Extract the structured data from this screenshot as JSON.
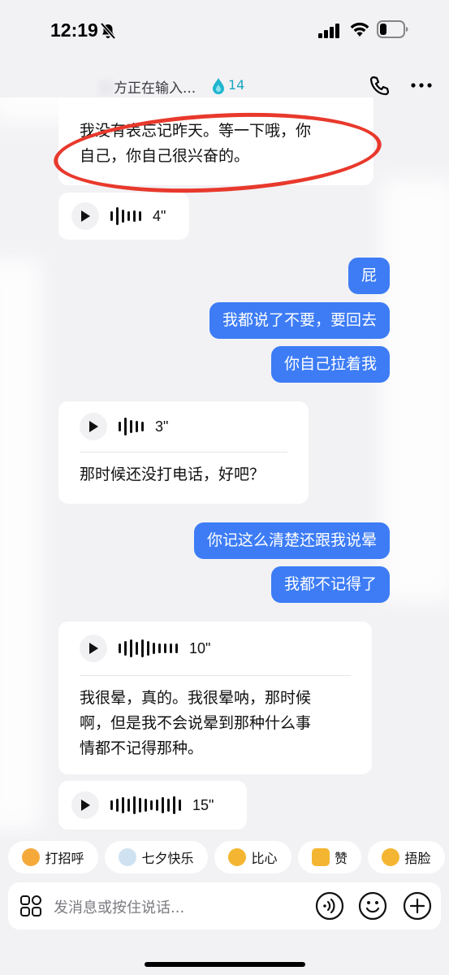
{
  "status_bar": {
    "time": "12:19"
  },
  "header": {
    "status_text": "方正在输入...",
    "streak_count": "14"
  },
  "messages": [
    {
      "side": "in",
      "type": "text",
      "text_line1": "我没有表忘记昨天。等一下哦，你",
      "text_line2": "自己，你自己很兴奋的。"
    },
    {
      "side": "in",
      "type": "voice",
      "duration": "4\""
    },
    {
      "side": "out",
      "text": "屁"
    },
    {
      "side": "out",
      "text": "我都说了不要，要回去"
    },
    {
      "side": "out",
      "text": "你自己拉着我"
    },
    {
      "side": "in",
      "type": "voice_text",
      "duration": "3\"",
      "text": "那时候还没打电话，好吧？"
    },
    {
      "side": "out",
      "text": "你记这么清楚还跟我说晕"
    },
    {
      "side": "out",
      "text": "我都不记得了"
    },
    {
      "side": "in",
      "type": "voice_text",
      "duration": "10\"",
      "text_line1": "我很晕，真的。我很晕呐，那时候",
      "text_line2": "啊，但是我不会说晕到那种什么事",
      "text_line3": "情都不记得那种。"
    },
    {
      "side": "in",
      "type": "voice",
      "duration": "15\""
    }
  ],
  "quick_replies": [
    {
      "label": "打招呼",
      "icon": "smile-emoji-icon",
      "color": "#f6a93b"
    },
    {
      "label": "七夕快乐",
      "icon": "magpie-icon",
      "color": "#9ec6e8"
    },
    {
      "label": "比心",
      "icon": "heart-hands-emoji-icon",
      "color": "#f4b632"
    },
    {
      "label": "赞",
      "icon": "thumbs-up-icon",
      "color": "#f4b632"
    },
    {
      "label": "捂脸",
      "icon": "facepalm-emoji-icon",
      "color": "#f4b632"
    }
  ],
  "input": {
    "placeholder": "发消息或按住说话..."
  },
  "colors": {
    "outgoing_bubble": "#3d7cf5",
    "incoming_bubble": "#ffffff",
    "annotation": "#e8392c",
    "streak": "#1aa6c0"
  }
}
